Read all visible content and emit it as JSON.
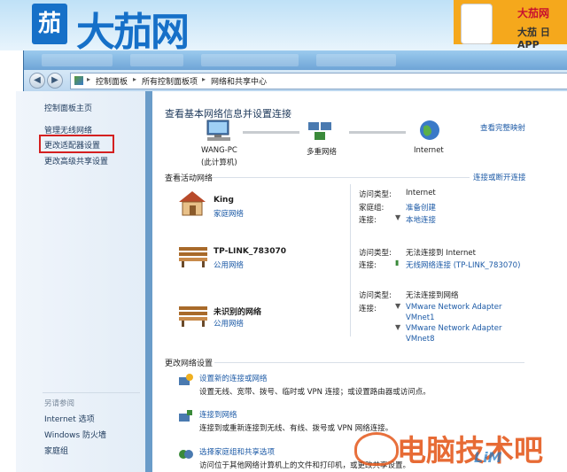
{
  "banner": {
    "logo_box": "茄",
    "logo_text": "大茄网",
    "ad_title": "大茄网",
    "ad_subtitle": "大茄 日 APP"
  },
  "breadcrumb": [
    "控制面板",
    "所有控制面板项",
    "网络和共享中心"
  ],
  "sidebar": {
    "items": [
      "控制面板主页",
      "管理无线网络",
      "更改适配器设置",
      "更改高级共享设置"
    ],
    "see_also_title": "另请参阅",
    "see_also": [
      "Internet 选项",
      "Windows 防火墙",
      "家庭组"
    ]
  },
  "main": {
    "title": "查看基本网络信息并设置连接",
    "view_full_map": "查看完整映射",
    "map": {
      "pc_name": "WANG-PC",
      "pc_sub": "(此计算机)",
      "multi_network": "多重网络",
      "internet": "Internet"
    },
    "active_header": "查看活动网络",
    "connect_disconnect": "连接或断开连接",
    "networks": [
      {
        "name": "King",
        "type": "家庭网络",
        "rows": [
          {
            "label": "访问类型:",
            "value": "Internet"
          },
          {
            "label": "家庭组:",
            "value": "准备创建"
          },
          {
            "label": "连接:",
            "value": "本地连接"
          }
        ]
      },
      {
        "name": "TP-LINK_783070",
        "type": "公用网络",
        "rows": [
          {
            "label": "访问类型:",
            "value": "无法连接到 Internet"
          },
          {
            "label": "连接:",
            "value": "无线网络连接 (TP-LINK_783070)"
          }
        ]
      },
      {
        "name": "未识别的网络",
        "type": "公用网络",
        "rows": [
          {
            "label": "访问类型:",
            "value": "无法连接到网络"
          },
          {
            "label": "连接:",
            "value": "VMware Network Adapter"
          },
          {
            "label": "",
            "value": "VMnet1"
          },
          {
            "label": "",
            "value": "VMware Network Adapter"
          },
          {
            "label": "",
            "value": "VMnet8"
          }
        ]
      }
    ],
    "change_header": "更改网络设置",
    "tasks": [
      {
        "title": "设置新的连接或网络",
        "desc": "设置无线、宽带、拨号、临时或 VPN 连接；或设置路由器或访问点。"
      },
      {
        "title": "连接到网络",
        "desc": "连接到或重新连接到无线、有线、拨号或 VPN 网络连接。"
      },
      {
        "title": "选择家庭组和共享选项",
        "desc": "访问位于其他网络计算机上的文件和打印机，或更改共享设置。"
      }
    ]
  },
  "watermark": {
    "text": "电脑技术吧",
    "sub": "LiM"
  }
}
